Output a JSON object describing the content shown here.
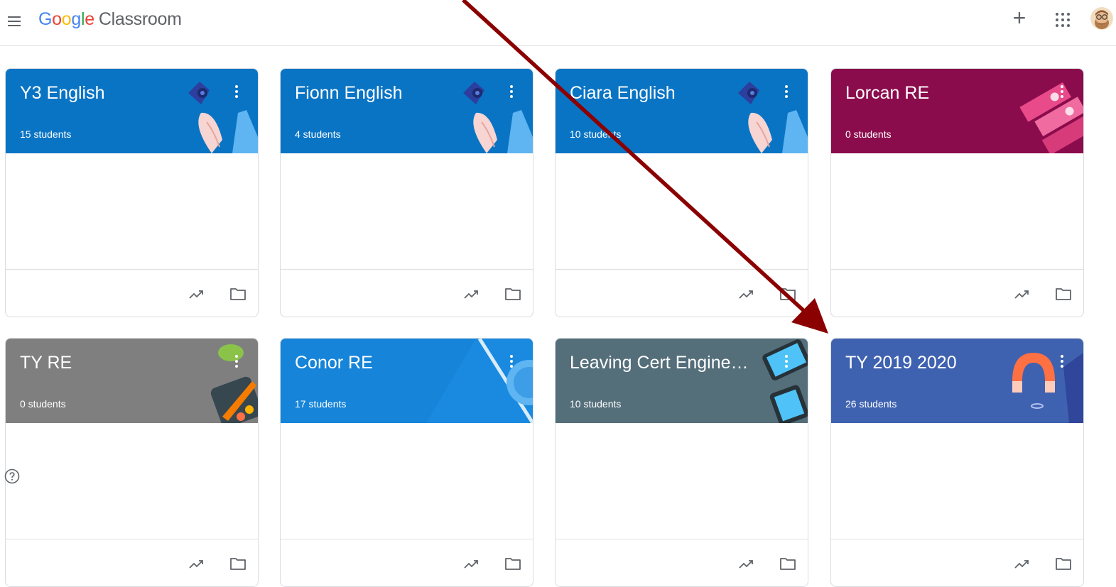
{
  "header": {
    "logo": {
      "g": "G",
      "o1": "o",
      "o2": "o",
      "g2": "g",
      "l": "l",
      "e": "e",
      "product": "Classroom"
    },
    "add_label": "+"
  },
  "classes": [
    {
      "title": "Y3 English",
      "students": "15 students",
      "theme": "blue",
      "color": "#0a74c4"
    },
    {
      "title": "Fionn English",
      "students": "4 students",
      "theme": "blue",
      "color": "#0a74c4"
    },
    {
      "title": "Ciara English",
      "students": "10 students",
      "theme": "blue",
      "color": "#0a74c4"
    },
    {
      "title": "Lorcan RE",
      "students": "0 students",
      "theme": "magenta",
      "color": "#8b0c4c"
    },
    {
      "title": "TY RE",
      "students": "0 students",
      "theme": "gray",
      "color": "#7f7f7f"
    },
    {
      "title": "Conor RE",
      "students": "17 students",
      "theme": "blue-light",
      "color": "#1584d9"
    },
    {
      "title": "Leaving Cert Enginee...",
      "students": "10 students",
      "theme": "slate",
      "color": "#546e7a"
    },
    {
      "title": "TY 2019 2020",
      "students": "26 students",
      "theme": "indigo",
      "color": "#3f62b0"
    }
  ],
  "annotation_arrow_color": "#8b0000"
}
